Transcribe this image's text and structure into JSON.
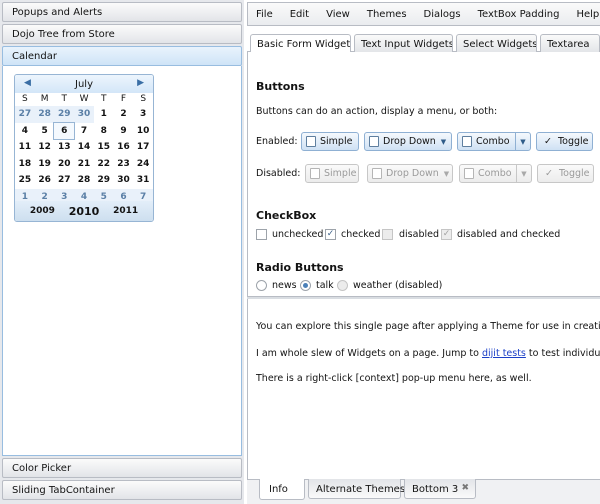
{
  "accordion": {
    "popups_title": "Popups and Alerts",
    "dojo_tree_title": "Dojo Tree from Store",
    "calendar_title": "Calendar",
    "color_picker_title": "Color Picker",
    "sliding_title": "Sliding TabContainer"
  },
  "calendar": {
    "month": "July",
    "prev_icon": "triangle-left-icon",
    "next_icon": "triangle-right-icon",
    "weekdays": [
      "S",
      "M",
      "T",
      "W",
      "T",
      "F",
      "S"
    ],
    "weeks": [
      [
        "27",
        "28",
        "29",
        "30",
        "1",
        "2",
        "3"
      ],
      [
        "4",
        "5",
        "6",
        "7",
        "8",
        "9",
        "10"
      ],
      [
        "11",
        "12",
        "13",
        "14",
        "15",
        "16",
        "17"
      ],
      [
        "18",
        "19",
        "20",
        "21",
        "22",
        "23",
        "24"
      ],
      [
        "25",
        "26",
        "27",
        "28",
        "29",
        "30",
        "31"
      ],
      [
        "1",
        "2",
        "3",
        "4",
        "5",
        "6",
        "7"
      ]
    ],
    "years": {
      "prev": "2009",
      "current": "2010",
      "next": "2011"
    }
  },
  "menubar": [
    "File",
    "Edit",
    "View",
    "Themes",
    "Dialogs",
    "TextBox Padding",
    "Help"
  ],
  "top_tabs": [
    "Basic Form Widgets",
    "Text Input Widgets",
    "Select Widgets",
    "Textarea"
  ],
  "form": {
    "buttons_heading": "Buttons",
    "buttons_desc": "Buttons can do an action, display a menu, or both:",
    "enabled_label": "Enabled:",
    "disabled_label": "Disabled:",
    "simple_label": "Simple",
    "dropdown_label": "Drop Down",
    "combo_label": "Combo",
    "toggle_label": "Toggle",
    "toggle_check": "✓",
    "checkbox_heading": "CheckBox",
    "cb_unchecked": "unchecked",
    "cb_checked": "checked",
    "cb_disabled": "disabled",
    "cb_disabled_checked": "disabled and checked",
    "radio_heading": "Radio Buttons",
    "radio_news": "news",
    "radio_talk": "talk",
    "radio_weather": "weather (disabled)"
  },
  "info": {
    "para1": "You can explore this single page after applying a Theme for use in creation",
    "para2_prefix": "I am whole slew of Widgets on a page. Jump to ",
    "para2_link": "dijit tests",
    "para2_suffix": " to test individual",
    "para3": "There is a right-click [context] pop-up menu here, as well."
  },
  "bottom_tabs": {
    "info": "Info",
    "alternate": "Alternate Themes",
    "bottom3": "Bottom 3",
    "close_glyph": "✖"
  },
  "colors": {
    "accent": "#cfe4f7",
    "link": "#1b3fc7",
    "border": "#b8bcc4"
  }
}
